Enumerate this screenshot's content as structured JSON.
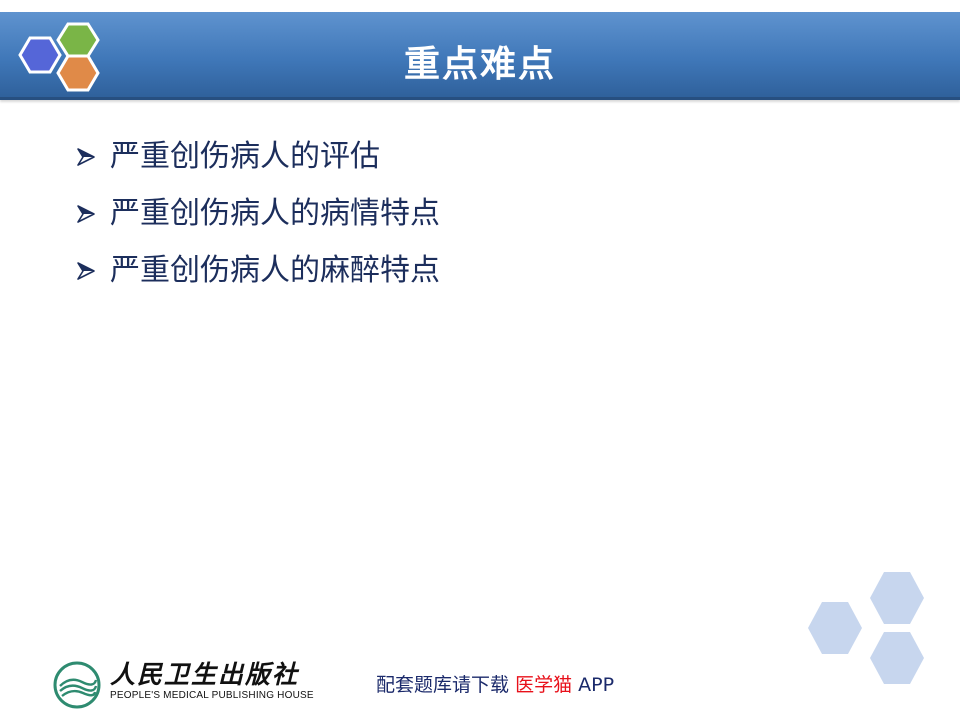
{
  "header": {
    "title": "重点难点"
  },
  "colors": {
    "header_blue": "#3f77b8",
    "hex_blue": "#5566d8",
    "hex_green": "#7ab547",
    "hex_orange": "#e08a48",
    "deco_hex": "#c7d6ee",
    "bullet_text": "#1c2e5c",
    "promo_red": "#e8101a"
  },
  "bullets": [
    {
      "icon": "arrow-bullet-icon",
      "text": "严重创伤病人的评估"
    },
    {
      "icon": "arrow-bullet-icon",
      "text": "严重创伤病人的病情特点"
    },
    {
      "icon": "arrow-bullet-icon",
      "text": "严重创伤病人的麻醉特点"
    }
  ],
  "footer": {
    "publisher_cn": "人民卫生出版社",
    "publisher_en": "PEOPLE'S MEDICAL PUBLISHING HOUSE",
    "promo_prefix": "配套题库请下载",
    "promo_app": "医学猫",
    "promo_suffix": "APP"
  }
}
